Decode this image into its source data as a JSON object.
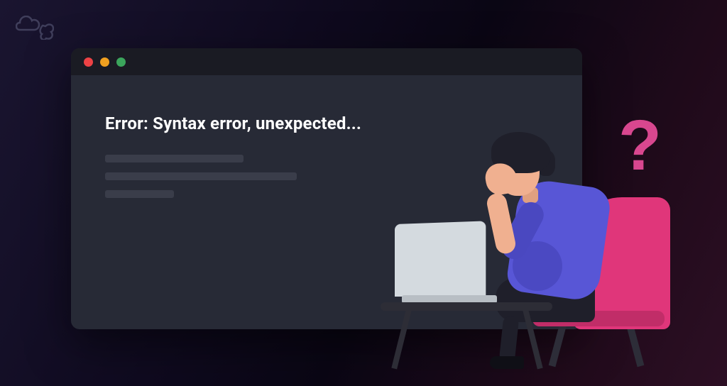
{
  "error_message": "Error: Syntax error, unexpected...",
  "question_mark": "?",
  "window": {
    "traffic_red": "close",
    "traffic_yellow": "minimize",
    "traffic_green": "maximize"
  }
}
